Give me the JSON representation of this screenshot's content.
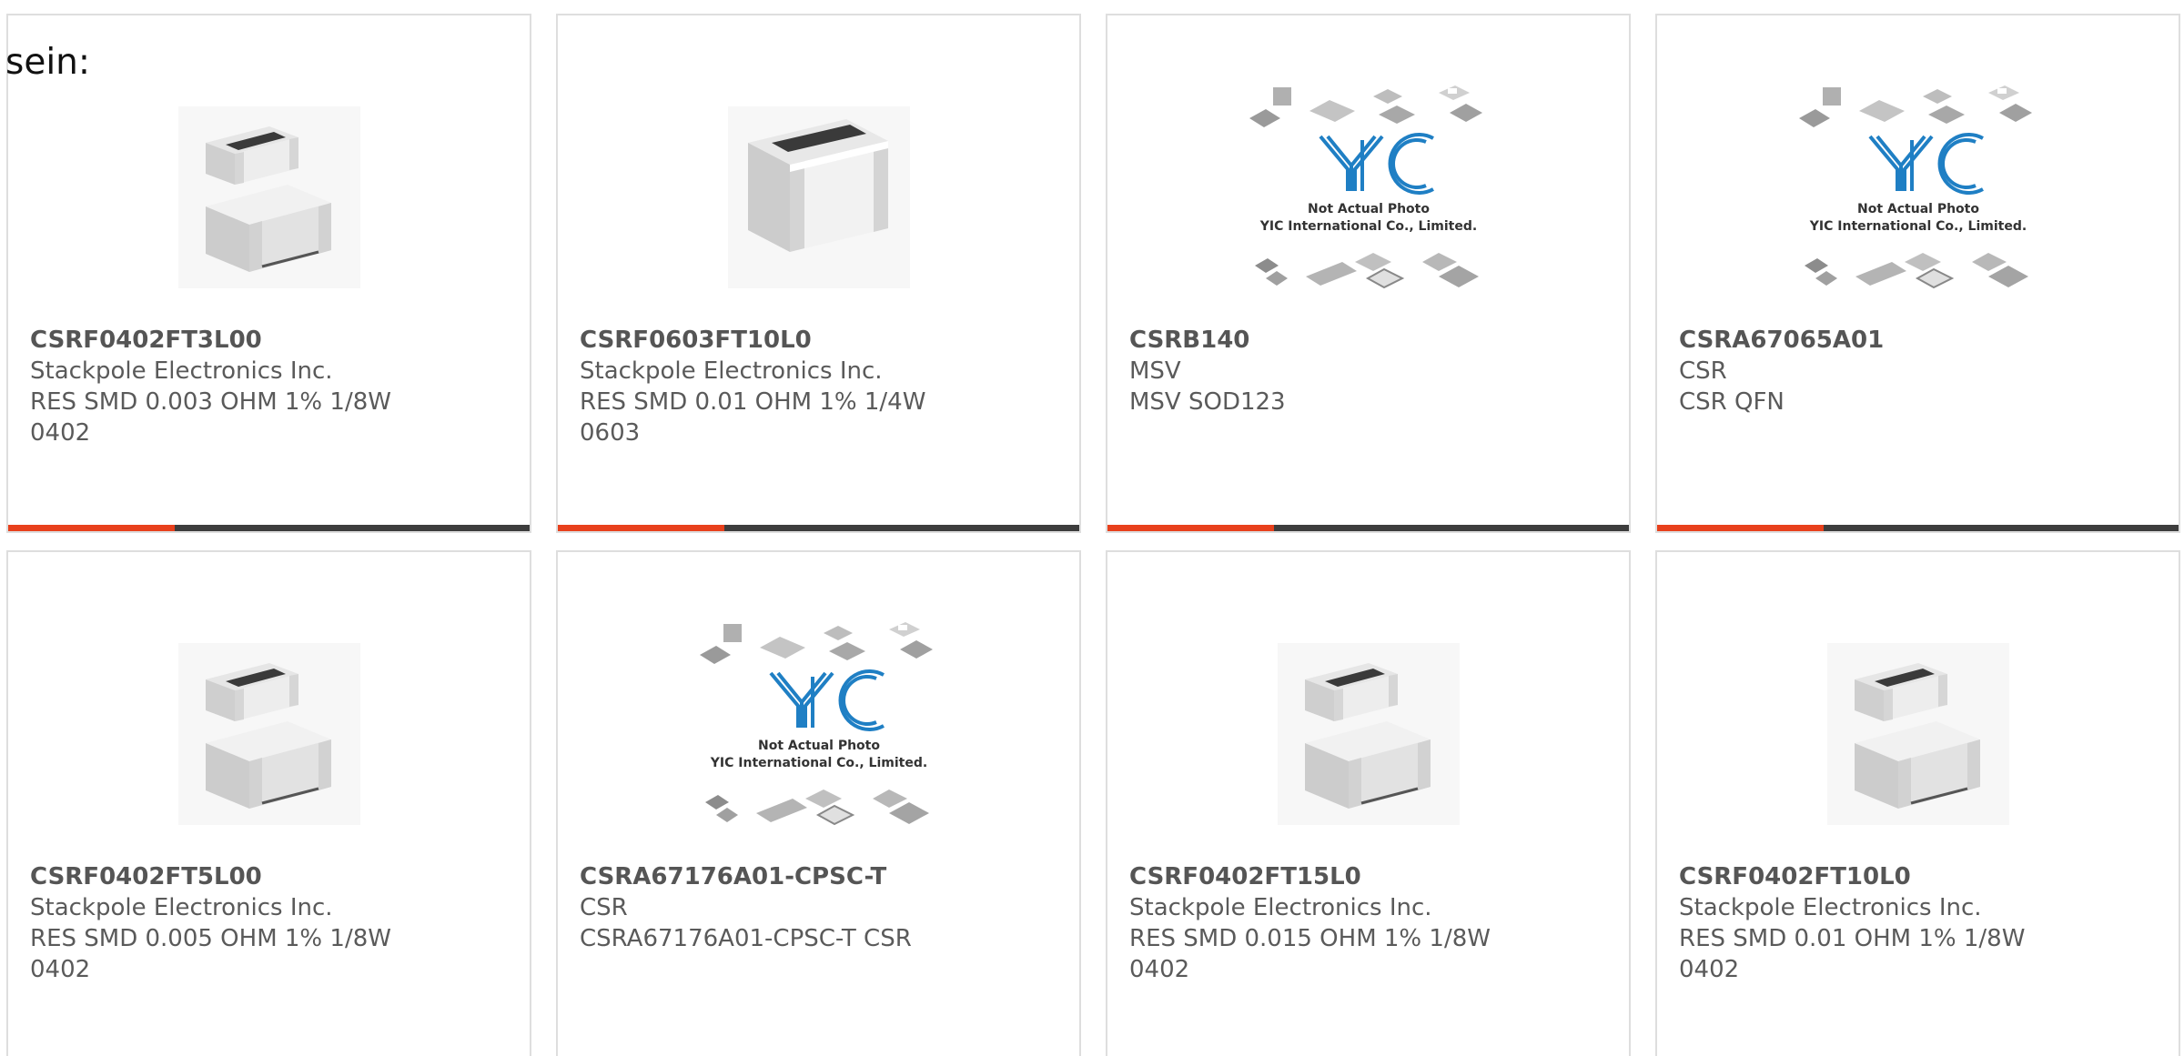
{
  "lead_text": "sein:",
  "colors": {
    "accent": "#e8401c",
    "bar": "#3d3d3d",
    "border": "#dedede",
    "text": "#5a5a5a",
    "yic_logo": "#1f7fc4"
  },
  "cards": [
    {
      "part_number": "CSRF0402FT3L00",
      "manufacturer": "Stackpole Electronics Inc.",
      "description": "RES SMD 0.003 OHM 1% 1/8W",
      "package": "0402",
      "image": "resistor-chip-small"
    },
    {
      "part_number": "CSRF0603FT10L0",
      "manufacturer": "Stackpole Electronics Inc.",
      "description": "RES SMD 0.01 OHM 1% 1/4W",
      "package": "0603",
      "image": "resistor-chip-large"
    },
    {
      "part_number": "CSRB140",
      "manufacturer": "MSV",
      "description": "MSV SOD123",
      "package": "",
      "image": "yic-placeholder",
      "placeholder_line1": "Not Actual Photo",
      "placeholder_line2": "YIC International Co., Limited."
    },
    {
      "part_number": "CSRA67065A01",
      "manufacturer": "CSR",
      "description": "CSR QFN",
      "package": "",
      "image": "yic-placeholder",
      "placeholder_line1": "Not Actual Photo",
      "placeholder_line2": "YIC International Co., Limited."
    },
    {
      "part_number": "CSRF0402FT5L00",
      "manufacturer": "Stackpole Electronics Inc.",
      "description": "RES SMD 0.005 OHM 1% 1/8W",
      "package": "0402",
      "image": "resistor-chip-small"
    },
    {
      "part_number": "CSRA67176A01-CPSC-T",
      "manufacturer": "CSR",
      "description": "CSRA67176A01-CPSC-T CSR",
      "package": "",
      "image": "yic-placeholder",
      "placeholder_line1": "Not Actual Photo",
      "placeholder_line2": "YIC International Co., Limited."
    },
    {
      "part_number": "CSRF0402FT15L0",
      "manufacturer": "Stackpole Electronics Inc.",
      "description": "RES SMD 0.015 OHM 1% 1/8W",
      "package": "0402",
      "image": "resistor-chip-small"
    },
    {
      "part_number": "CSRF0402FT10L0",
      "manufacturer": "Stackpole Electronics Inc.",
      "description": "RES SMD 0.01 OHM 1% 1/8W",
      "package": "0402",
      "image": "resistor-chip-small"
    }
  ]
}
